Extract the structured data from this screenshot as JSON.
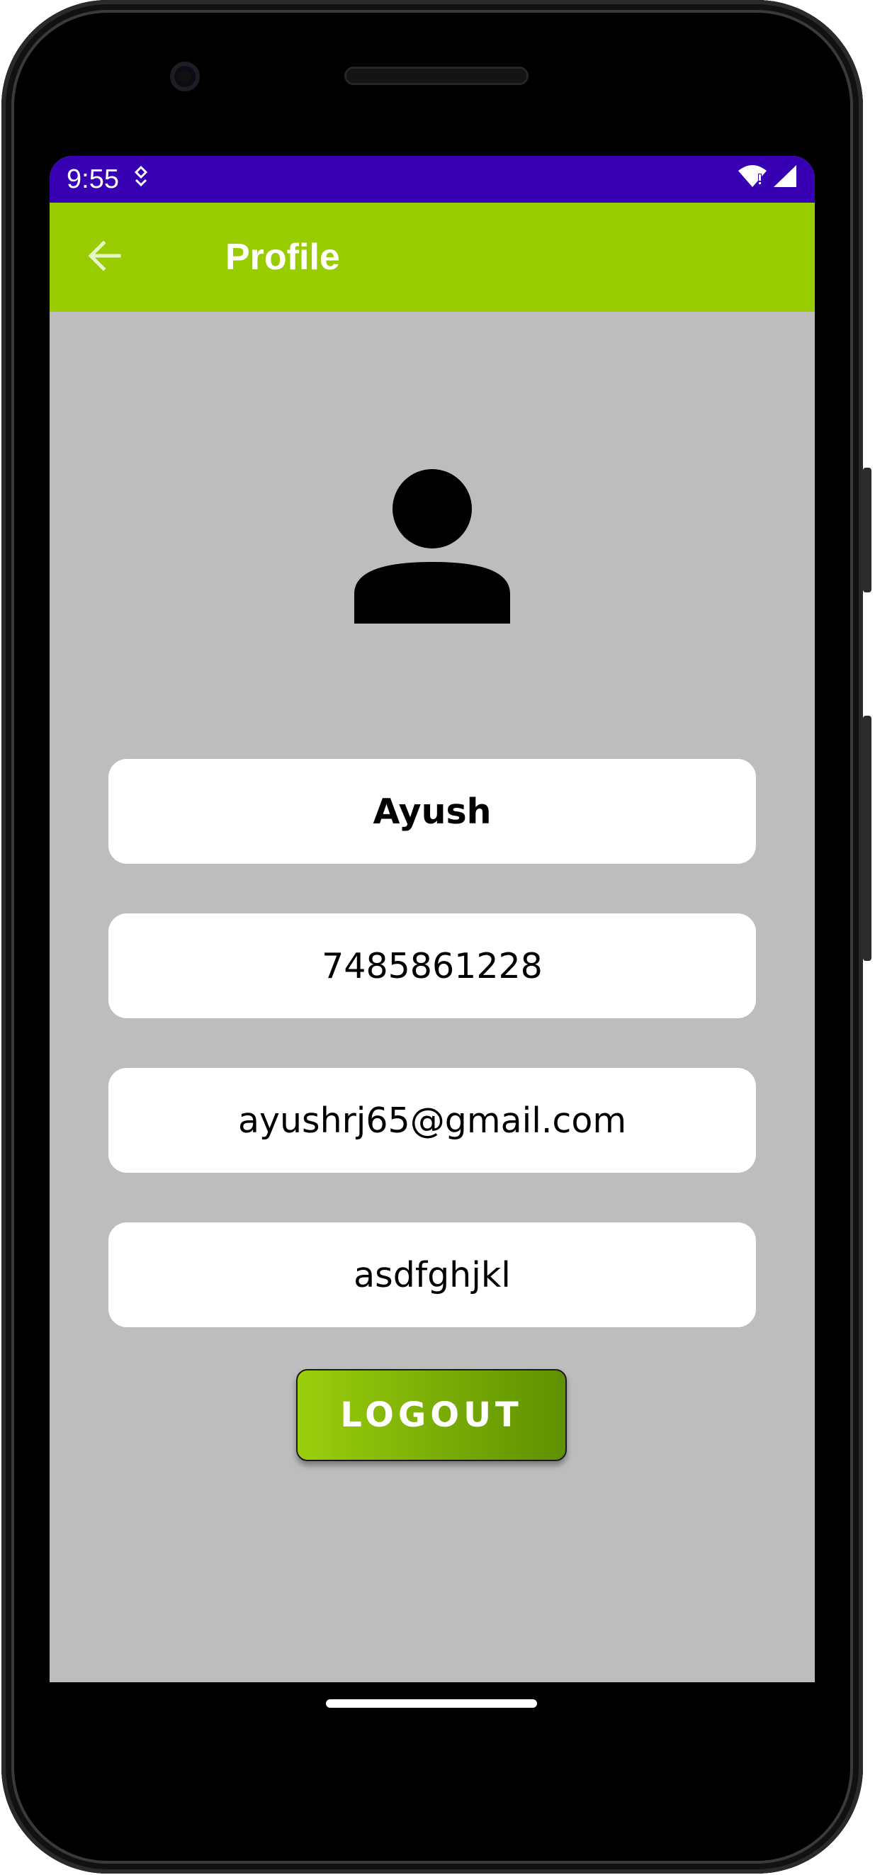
{
  "status_bar": {
    "time": "9:55",
    "app_icon": "notification-icon",
    "wifi_icon": "wifi-icon",
    "signal_icon": "signal-icon"
  },
  "app_bar": {
    "title": "Profile",
    "back_icon": "arrow-left-icon",
    "color": "#99cc00"
  },
  "profile": {
    "avatar_icon": "person-icon",
    "name": "Ayush",
    "phone": "7485861228",
    "email": "ayushrj65@gmail.com",
    "password": "asdfghjkl"
  },
  "actions": {
    "logout_label": "LOGOUT"
  },
  "colors": {
    "status_bar": "#3700b3",
    "accent": "#99cc00",
    "background": "#bdbdbd"
  }
}
